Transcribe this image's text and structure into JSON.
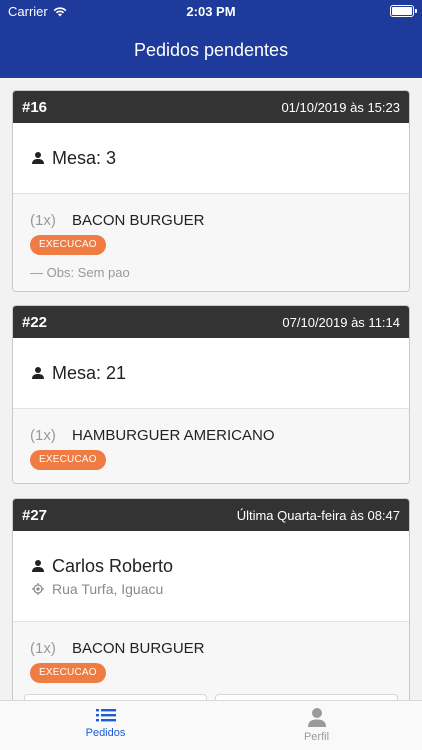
{
  "statusbar": {
    "carrier": "Carrier",
    "time": "2:03 PM"
  },
  "navbar": {
    "title": "Pedidos pendentes"
  },
  "orders": [
    {
      "number": "#16",
      "date": "01/10/2019 às 15:23",
      "customer": "Mesa: 3",
      "address": null,
      "items": [
        {
          "qty": "(1x)",
          "name": "BACON BURGUER",
          "status": "EXECUCAO",
          "obs": "— Obs: Sem pao"
        }
      ]
    },
    {
      "number": "#22",
      "date": "07/10/2019 às 11:14",
      "customer": "Mesa: 21",
      "address": null,
      "items": [
        {
          "qty": "(1x)",
          "name": "HAMBURGUER AMERICANO",
          "status": "EXECUCAO",
          "obs": null
        }
      ]
    },
    {
      "number": "#27",
      "date": "Última Quarta-feira às 08:47",
      "customer": "Carlos Roberto",
      "address": "Rua Turfa, Iguacu",
      "items": [
        {
          "qty": "(1x)",
          "name": "BACON BURGUER",
          "status": "EXECUCAO",
          "obs": null
        }
      ]
    }
  ],
  "tabbar": {
    "tabs": [
      {
        "label": "Pedidos",
        "icon": "list-icon",
        "active": true
      },
      {
        "label": "Perfil",
        "icon": "person-icon",
        "active": false
      }
    ]
  },
  "colors": {
    "primary": "#1e3a9a",
    "badge": "#ef7c43",
    "header": "#333333",
    "tab_active": "#1e5bd6"
  }
}
